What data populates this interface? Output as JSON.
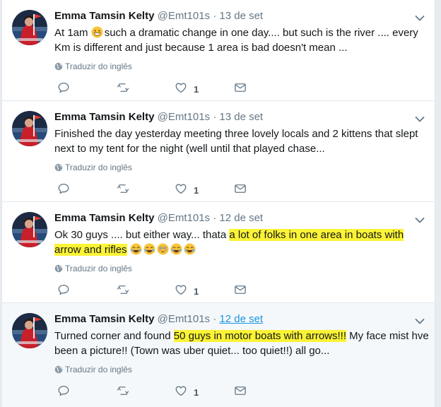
{
  "colors": {
    "highlight": "#fbf335",
    "link": "#1b95e0",
    "muted": "#657786"
  },
  "tweets": [
    {
      "author_name": "Emma Tamsin Kelty",
      "author_handle": "@Emt101s",
      "separator": "·",
      "date": "13 de set",
      "text_parts": [
        {
          "t": "At 1am "
        },
        {
          "emoji": "grinning-face"
        },
        {
          "t": "such a dramatic change in one day.... but such is the river .... every Km is different and just because 1 area is bad doesn't mean ..."
        }
      ],
      "translate_label": "Traduzir do inglês",
      "like_count": "1"
    },
    {
      "author_name": "Emma Tamsin Kelty",
      "author_handle": "@Emt101s",
      "separator": "·",
      "date": "13 de set",
      "text_parts": [
        {
          "t": "Finished the day yesterday meeting three lovely locals and 2 kittens that slept next to my tent for the night (well until that played chase..."
        }
      ],
      "translate_label": "Traduzir do inglês",
      "like_count": "1"
    },
    {
      "author_name": "Emma Tamsin Kelty",
      "author_handle": "@Emt101s",
      "separator": "·",
      "date": "12 de set",
      "text_parts": [
        {
          "t": "Ok 30 guys .... but either way... thata "
        },
        {
          "hl": "a lot of folks in one area in boats with arrow and rifles"
        },
        {
          "t": " "
        },
        {
          "emoji": "tears-of-joy"
        },
        {
          "emoji": "tears-of-joy"
        },
        {
          "emoji": "flushed-face"
        },
        {
          "emoji": "tears-of-joy"
        },
        {
          "emoji": "tears-of-joy"
        }
      ],
      "translate_label": "Traduzir do inglês",
      "like_count": "1"
    },
    {
      "author_name": "Emma Tamsin Kelty",
      "author_handle": "@Emt101s",
      "separator": "·",
      "date": "12 de set",
      "date_link": true,
      "text_parts": [
        {
          "t": "Turned corner and found "
        },
        {
          "hl": "50 guys in motor boats with arrows!!!"
        },
        {
          "t": " My face mist hve been a picture!! (Town was uber quiet... too quiet!!) all go..."
        }
      ],
      "translate_label": "Traduzir do inglês",
      "like_count": "1"
    }
  ]
}
